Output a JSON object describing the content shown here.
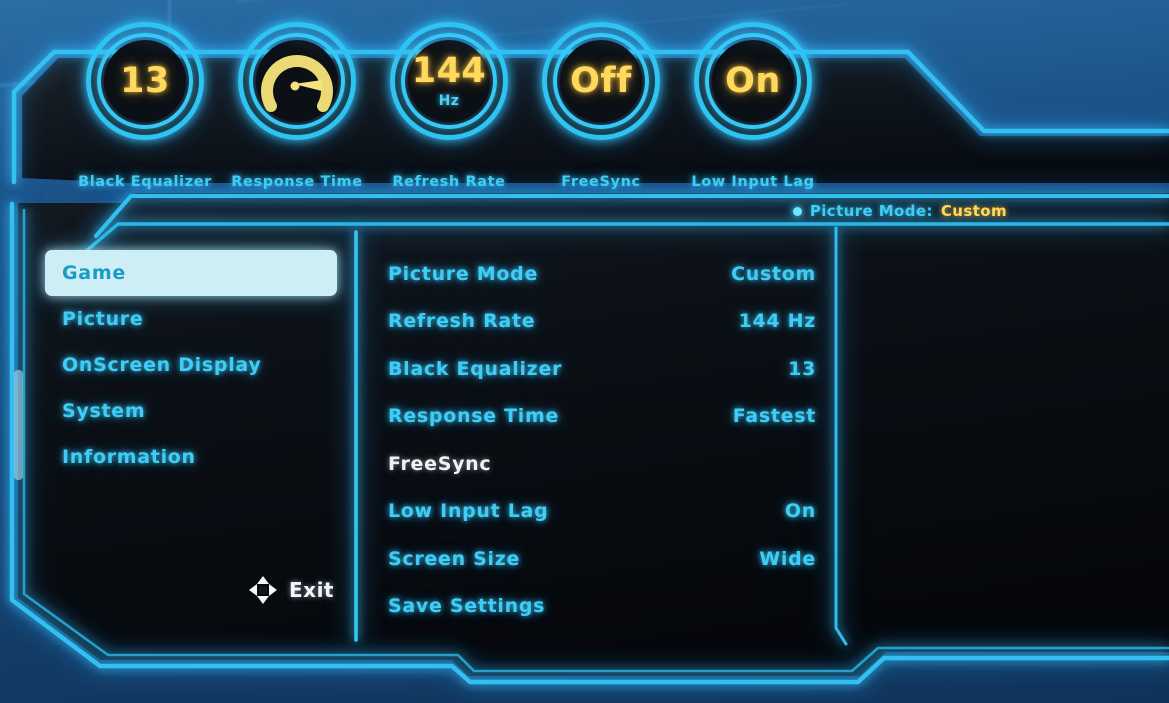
{
  "quick_dials": [
    {
      "name": "black-equalizer",
      "value": "13",
      "unit": "",
      "label": "Black Equalizer",
      "icon": "none"
    },
    {
      "name": "response-time",
      "value": "",
      "unit": "",
      "label": "Response Time",
      "icon": "gauge-icon"
    },
    {
      "name": "refresh-rate",
      "value": "144",
      "unit": "Hz",
      "label": "Refresh Rate",
      "icon": "none"
    },
    {
      "name": "freesync",
      "value": "Off",
      "unit": "",
      "label": "FreeSync",
      "icon": "none"
    },
    {
      "name": "low-input-lag",
      "value": "On",
      "unit": "",
      "label": "Low Input Lag",
      "icon": "none"
    }
  ],
  "status": {
    "label": "Picture Mode:",
    "value": "Custom"
  },
  "sidebar": {
    "items": [
      {
        "label": "Game",
        "active": true
      },
      {
        "label": "Picture",
        "active": false
      },
      {
        "label": "OnScreen Display",
        "active": false
      },
      {
        "label": "System",
        "active": false
      },
      {
        "label": "Information",
        "active": false
      }
    ]
  },
  "exit": {
    "label": "Exit",
    "icon": "dpad-navigation-icon"
  },
  "options": [
    {
      "label": "Picture Mode",
      "value": "Custom",
      "disabled": false
    },
    {
      "label": "Refresh Rate",
      "value": "144 Hz",
      "disabled": false
    },
    {
      "label": "Black Equalizer",
      "value": "13",
      "disabled": false
    },
    {
      "label": "Response Time",
      "value": "Fastest",
      "disabled": false
    },
    {
      "label": "FreeSync",
      "value": "",
      "disabled": true
    },
    {
      "label": "Low Input Lag",
      "value": "On",
      "disabled": false
    },
    {
      "label": "Screen Size",
      "value": "Wide",
      "disabled": false
    },
    {
      "label": "Save Settings",
      "value": "",
      "disabled": false
    }
  ],
  "colors": {
    "accent_cyan": "#3fcdf5",
    "accent_yellow": "#ffd95e",
    "highlight_bg": "#cdeef4",
    "highlight_text": "#1b9cc6",
    "panel_bg": "#0a0d12",
    "disabled_text": "#eef2f4"
  }
}
